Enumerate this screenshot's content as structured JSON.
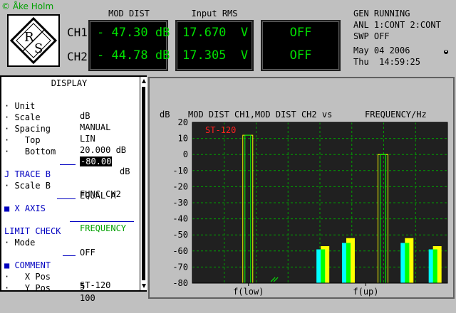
{
  "watermark": "© Åke Holm",
  "header": {
    "ch1_label": "CH1",
    "ch2_label": "CH2",
    "mod_dist_title": "MOD DIST",
    "input_rms_title": "Input RMS",
    "ch1_mod_dist": "- 47.30 dB",
    "ch2_mod_dist": "- 44.78 dB",
    "ch1_rms": "17.670  V",
    "ch2_rms": "17.305  V",
    "ch1_third": "OFF",
    "ch2_third": "OFF",
    "status_1": "GEN RUNNING",
    "status_2": "ANL 1:CONT 2:CONT",
    "status_3": "SWP OFF",
    "date": "May 04 2006",
    "time": "Thu  14:59:25",
    "display_color": "#00e000"
  },
  "settings": {
    "title": "DISPLAY",
    "rows": [
      {
        "label": "· Unit",
        "value": "dB"
      },
      {
        "label": "· Scale",
        "value": "MANUAL"
      },
      {
        "label": "· Spacing",
        "value": "LIN"
      },
      {
        "label": "·   Top",
        "value": "20.000 dB"
      },
      {
        "label": "·   Bottom",
        "value": "-80.00",
        "unit": "dB"
      },
      {
        "label": "J TRACE B",
        "value": "FUNC CH2"
      },
      {
        "label": "· Scale B",
        "value": "EQUAL A"
      },
      {
        "label": "■ X AXIS",
        "value": "FREQUENCY"
      },
      {
        "label": "LIMIT CHECK",
        "value": ""
      },
      {
        "label": "· Mode",
        "value": "OFF"
      },
      {
        "label": "■ COMMENT",
        "value": "ST-120"
      },
      {
        "label": "·   X Pos",
        "value": "5"
      },
      {
        "label": "·   Y Pos",
        "value": "100"
      }
    ]
  },
  "chart_data": {
    "type": "bar",
    "title": "MOD DIST CH1,MOD DIST CH2 vs",
    "xlabel": "FREQUENCY/Hz",
    "ylabel": "dB",
    "annotation": "ST-120",
    "ylim": [
      -80,
      20
    ],
    "yticks": [
      20,
      10,
      0,
      -10,
      -20,
      -30,
      -40,
      -50,
      -60,
      -70,
      -80
    ],
    "xtick_labels": [
      "f(low)",
      "f(up)"
    ],
    "series": [
      {
        "name": "CH1",
        "values": [
          12,
          0,
          -59,
          -55,
          0,
          -55,
          -59
        ]
      },
      {
        "name": "CH2",
        "values": [
          12,
          0,
          -57,
          -52,
          0,
          -52,
          -57
        ]
      }
    ],
    "colors": {
      "ch1": "#00ffff",
      "ch2": "#ffff00",
      "mid": "#00ff00",
      "bg": "#202020",
      "grid": "#00a000"
    }
  }
}
